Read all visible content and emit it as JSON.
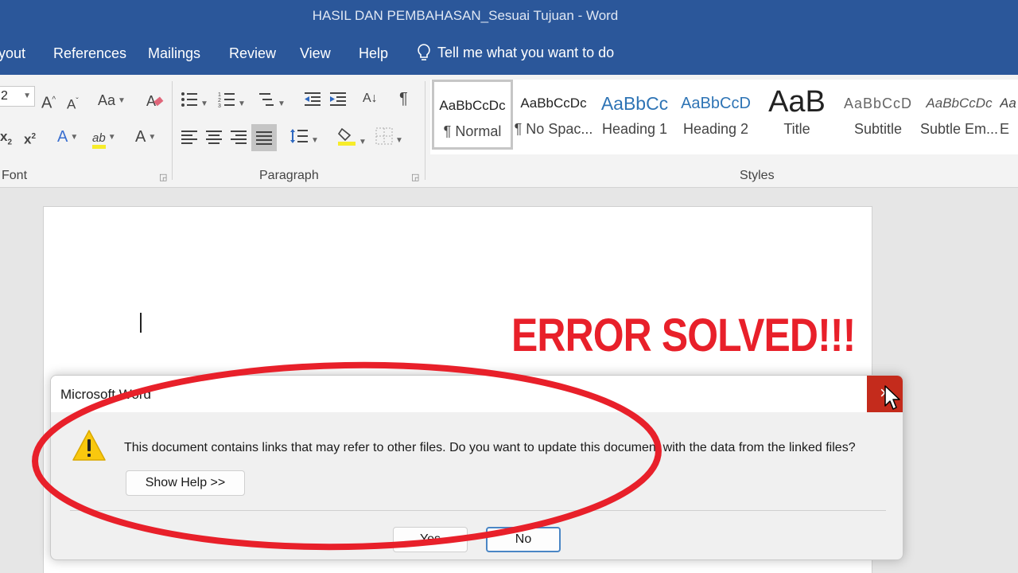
{
  "window": {
    "title": "HASIL DAN PEMBAHASAN_Sesuai Tujuan  -  Word"
  },
  "tabs": [
    "yout",
    "References",
    "Mailings",
    "Review",
    "View",
    "Help"
  ],
  "tell_me": "Tell me what you want to do",
  "ribbon": {
    "font_size_value": "2",
    "groups": {
      "font": "Font",
      "paragraph": "Paragraph",
      "styles": "Styles"
    },
    "styles_gallery": [
      {
        "sample": "AaBbCcDc",
        "name": "¶ Normal"
      },
      {
        "sample": "AaBbCcDc",
        "name": "¶ No Spac..."
      },
      {
        "sample": "AaBbCc",
        "name": "Heading 1"
      },
      {
        "sample": "AaBbCcD",
        "name": "Heading 2"
      },
      {
        "sample": "AaB",
        "name": "Title"
      },
      {
        "sample": "AaBbCcD",
        "name": "Subtitle"
      },
      {
        "sample": "AaBbCcDc",
        "name": "Subtle Em..."
      },
      {
        "sample": "Aa",
        "name": "E"
      }
    ],
    "icons": {
      "grow_font": "A",
      "shrink_font": "A",
      "change_case": "Aa",
      "subscript": "x",
      "superscript": "x",
      "font_color": "A",
      "sort": "A",
      "pilcrow": "¶",
      "sub2": "2",
      "sup2": "2",
      "highlight": "ab"
    }
  },
  "overlay": {
    "headline": "ERROR SOLVED!!!",
    "accent_color": "#e8202a"
  },
  "dialog": {
    "title": "Microsoft Word",
    "close": "×",
    "message": "This document contains links that may refer to other files. Do you want to update this document with the data from the linked files?",
    "show_help": "Show Help >>",
    "yes": "Yes",
    "no": "No"
  },
  "colors": {
    "word_blue": "#2b579a",
    "close_red": "#c42b1c"
  }
}
